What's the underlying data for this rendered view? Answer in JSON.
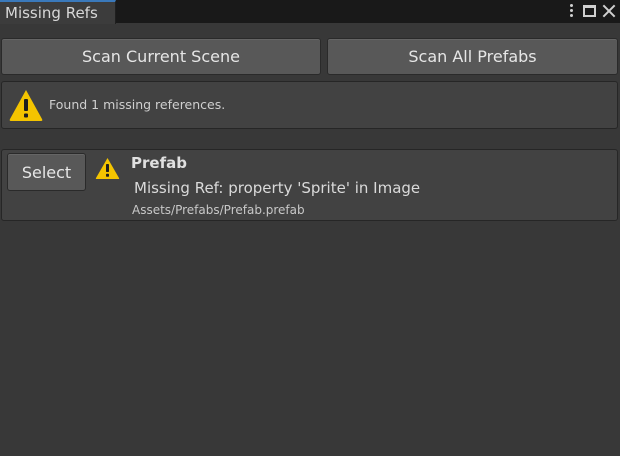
{
  "window": {
    "tab_title": "Missing Refs",
    "icons": [
      "kebab-menu-icon",
      "maximize-icon",
      "close-icon"
    ]
  },
  "toolbar": {
    "scan_scene_label": "Scan Current Scene",
    "scan_prefabs_label": "Scan All Prefabs"
  },
  "status": {
    "icon": "warning-icon",
    "message": "Found 1 missing references."
  },
  "results": [
    {
      "select_label": "Select",
      "icon": "warning-icon",
      "object_name": "Prefab",
      "detail": "Missing Ref: property 'Sprite' in Image",
      "path": "Assets/Prefabs/Prefab.prefab"
    }
  ],
  "colors": {
    "background": "#383838",
    "tab_accent": "#3a79bb",
    "warning": "#f4c400"
  }
}
